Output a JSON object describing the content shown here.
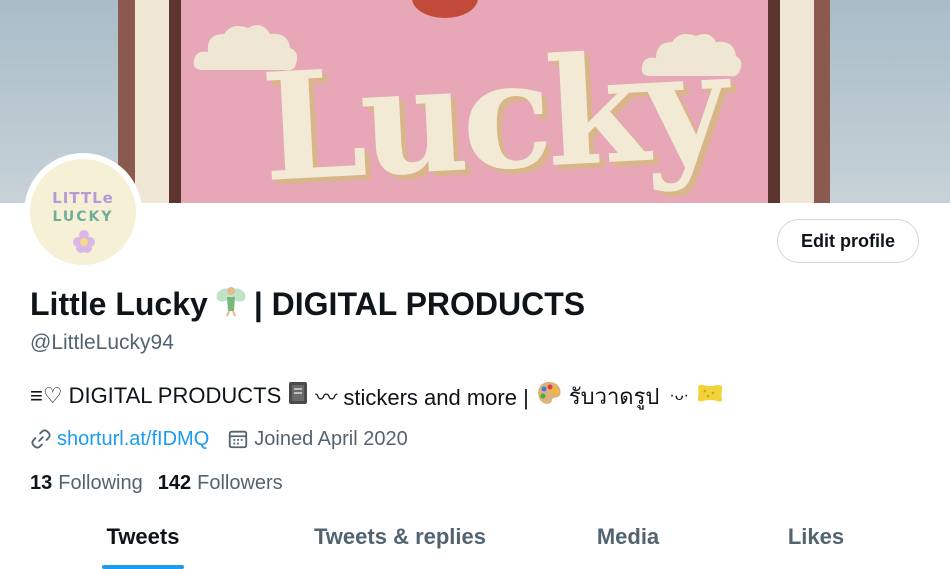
{
  "banner": {
    "poster_text": "Lucky"
  },
  "avatar": {
    "line1": "LITTLe",
    "line2": "LUCKY"
  },
  "header": {
    "edit_profile_label": "Edit profile"
  },
  "profile": {
    "name_part1": "Little Lucky",
    "name_part2": "| DIGITAL PRODUCTS",
    "handle": "@LittleLucky94",
    "bio": {
      "prefix_glyph": "≡♡",
      "text1": "DIGITAL PRODUCTS",
      "text2": "〰 stickers and more |",
      "text3": "รับวาดรูป",
      "text4": "·ᴗ·"
    },
    "link_text": "shorturl.at/fIDMQ",
    "joined_text": "Joined April 2020",
    "following_count": "13",
    "following_label": "Following",
    "followers_count": "142",
    "followers_label": "Followers"
  },
  "tabs": [
    {
      "label": "Tweets",
      "active": true
    },
    {
      "label": "Tweets & replies",
      "active": false
    },
    {
      "label": "Media",
      "active": false
    },
    {
      "label": "Likes",
      "active": false
    }
  ],
  "colors": {
    "accent": "#1d9bf0",
    "text_primary": "#0f1419",
    "text_secondary": "#536471",
    "poster_pink": "#e7a7b6"
  },
  "icons": [
    "fairy-emoji-icon",
    "notebook-emoji-icon",
    "palette-emoji-icon",
    "sponge-emoji-icon",
    "link-icon",
    "calendar-icon"
  ]
}
